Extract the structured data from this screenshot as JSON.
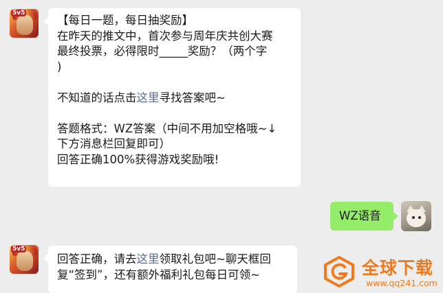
{
  "messages": {
    "first": {
      "lines": [
        {
          "text": "【每日一题，每日抽奖励】"
        },
        {
          "text": "在昨天的推文中，首次参与周年庆共创大赛"
        },
        {
          "text": "最终投票，必得限时_____奖励？（两个字"
        },
        {
          "text": ")"
        },
        {
          "text": ""
        },
        {
          "pre": "不知道的话点击",
          "link": "这里",
          "post": "寻找答案吧~"
        },
        {
          "text": ""
        },
        {
          "text": "答题格式：WZ答案（中间不用加空格哦~↓"
        },
        {
          "text": "下方消息栏回复即可）"
        },
        {
          "text": "回答正确100%获得游戏奖励哦!"
        }
      ]
    },
    "reply": {
      "text": "WZ语音"
    },
    "second": {
      "line1_pre": "回答正确，请去",
      "line1_link": "这里",
      "line1_post": "领取礼包吧~聊天框回",
      "line2": "复“签到”，还有额外福利礼包每日可领~"
    }
  },
  "watermark": {
    "title": "全球下载",
    "url": "www.qq241.com"
  },
  "colors": {
    "background": "#ededed",
    "bubble": "#ffffff",
    "reply_bubble": "#95ec69",
    "link": "#576b95",
    "watermark": "#f07a1a"
  },
  "icons": {
    "sender_avatar": "game-hero-avatar",
    "user_avatar": "cat-avatar",
    "watermark_logo": "g-logo-icon"
  }
}
